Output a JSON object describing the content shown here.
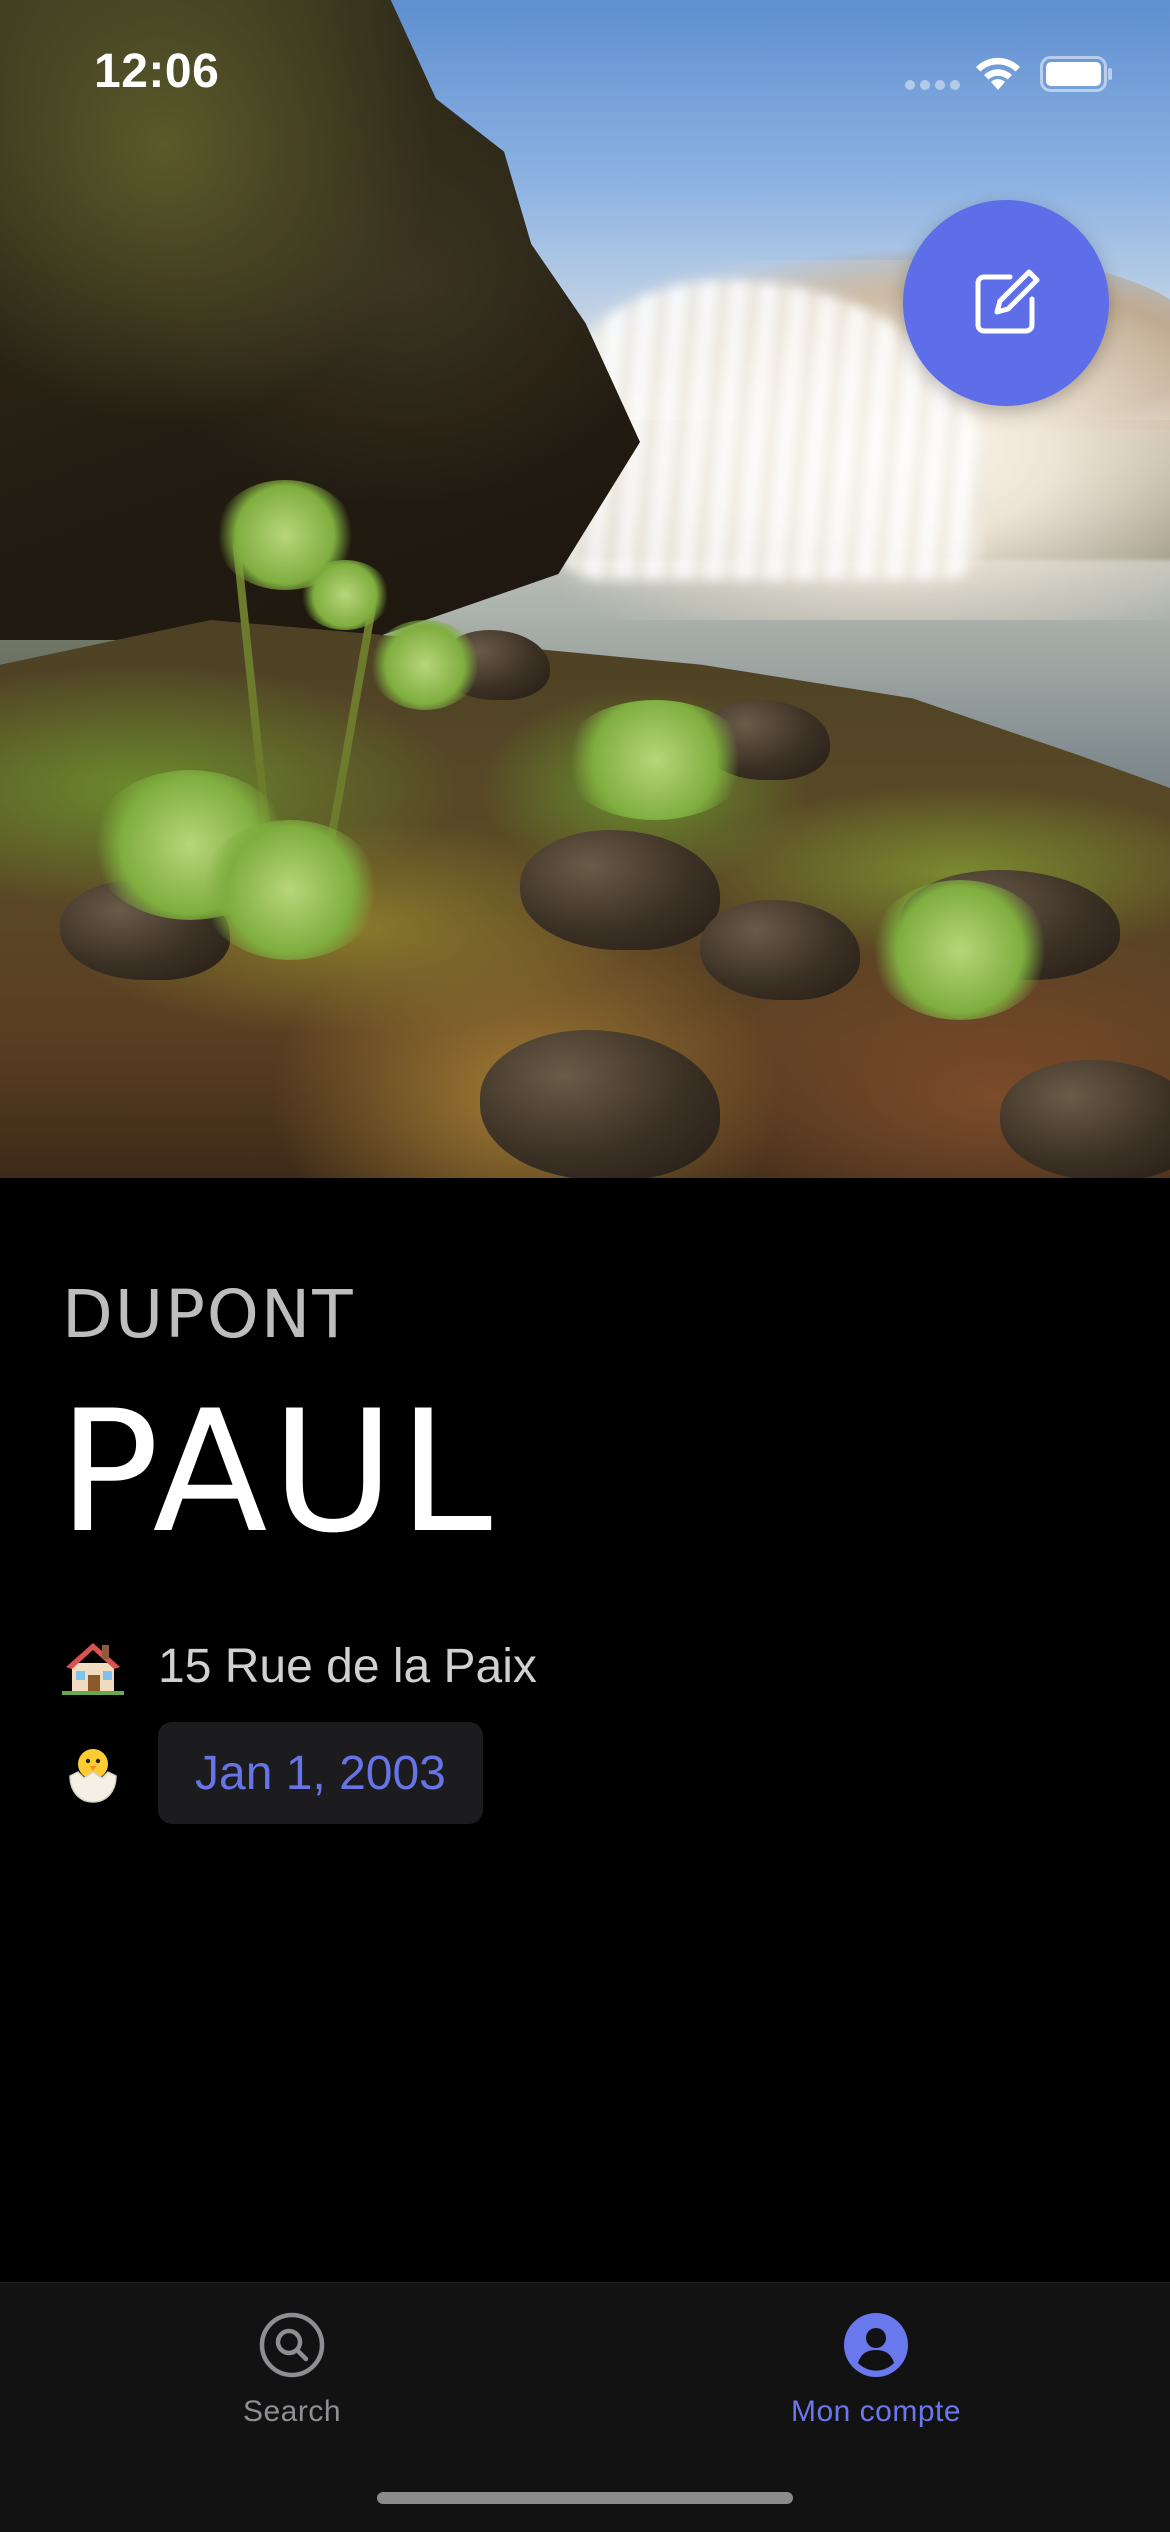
{
  "status_bar": {
    "time": "12:06"
  },
  "hero": {
    "image_description_icon": "waterfall-photo"
  },
  "fab": {
    "icon": "edit-icon",
    "color": "#5e6ee9"
  },
  "profile": {
    "last_name": "DUPONT",
    "first_name": "PAUL",
    "address_icon": "house-emoji",
    "address": "15 Rue de la Paix",
    "birth_icon": "hatching-chick-emoji",
    "birth_date": "Jan 1, 2003"
  },
  "tab_bar": {
    "tabs": [
      {
        "label": "Search",
        "icon": "search-icon",
        "active": false
      },
      {
        "label": "Mon compte",
        "icon": "account-icon",
        "active": true
      }
    ],
    "active_color": "#6a78ee",
    "inactive_color": "#8e8e93"
  }
}
